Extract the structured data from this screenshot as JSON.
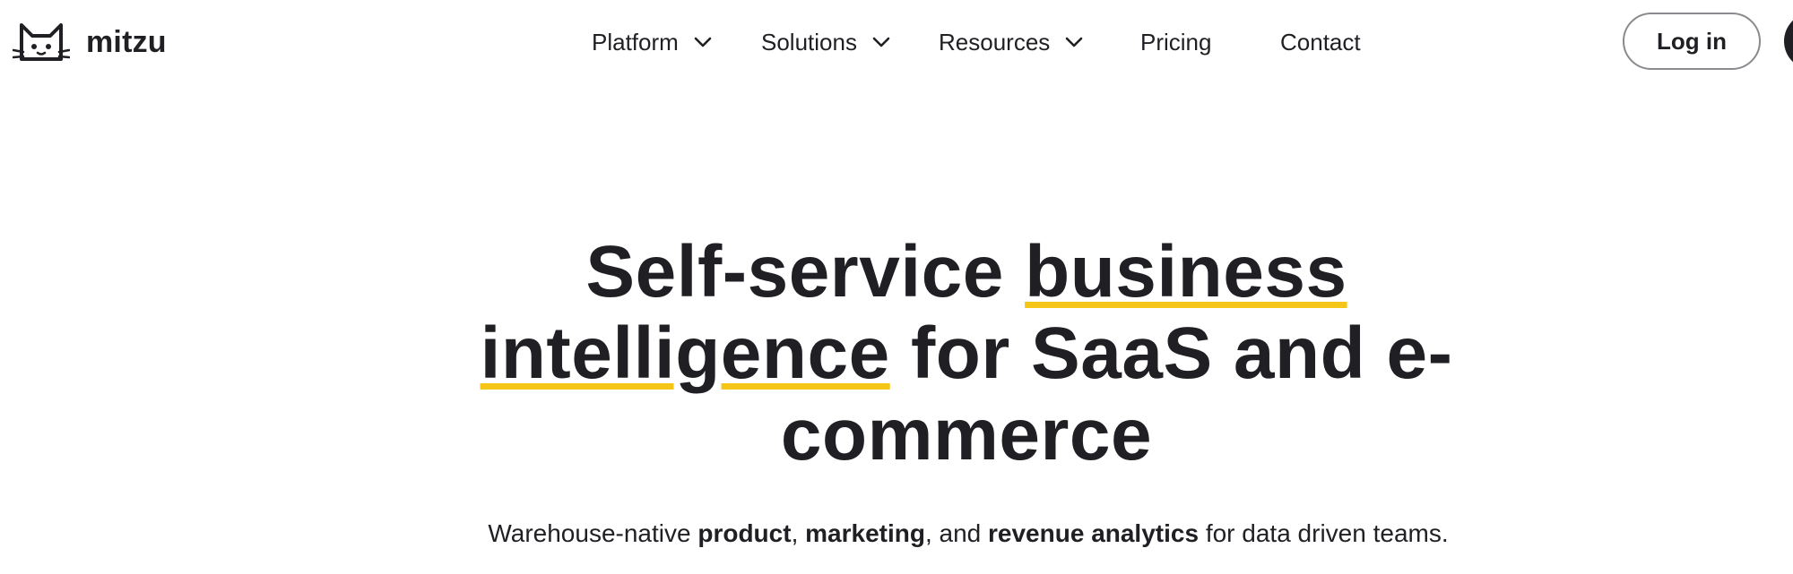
{
  "brand": {
    "name": "mitzu",
    "logo_icon": "cat-face-icon"
  },
  "nav": {
    "items": [
      {
        "label": "Platform",
        "has_dropdown": true
      },
      {
        "label": "Solutions",
        "has_dropdown": true
      },
      {
        "label": "Resources",
        "has_dropdown": true
      },
      {
        "label": "Pricing",
        "has_dropdown": false
      },
      {
        "label": "Contact",
        "has_dropdown": false
      }
    ],
    "login_label": "Log in"
  },
  "hero": {
    "title_parts": {
      "t1": "Self-service ",
      "t2": "business",
      "t3": " ",
      "t4": "intelligence",
      "t5": " for SaaS and e-commerce"
    },
    "subtitle_parts": {
      "s1": "Warehouse-native ",
      "s2": "product",
      "s3": ", ",
      "s4": "marketing",
      "s5": ", and ",
      "s6": "revenue analytics",
      "s7": " for data driven teams."
    }
  },
  "colors": {
    "text": "#1f1f24",
    "accent_underline": "#f5c518",
    "button_border": "#8a8a8f",
    "background": "#ffffff"
  }
}
